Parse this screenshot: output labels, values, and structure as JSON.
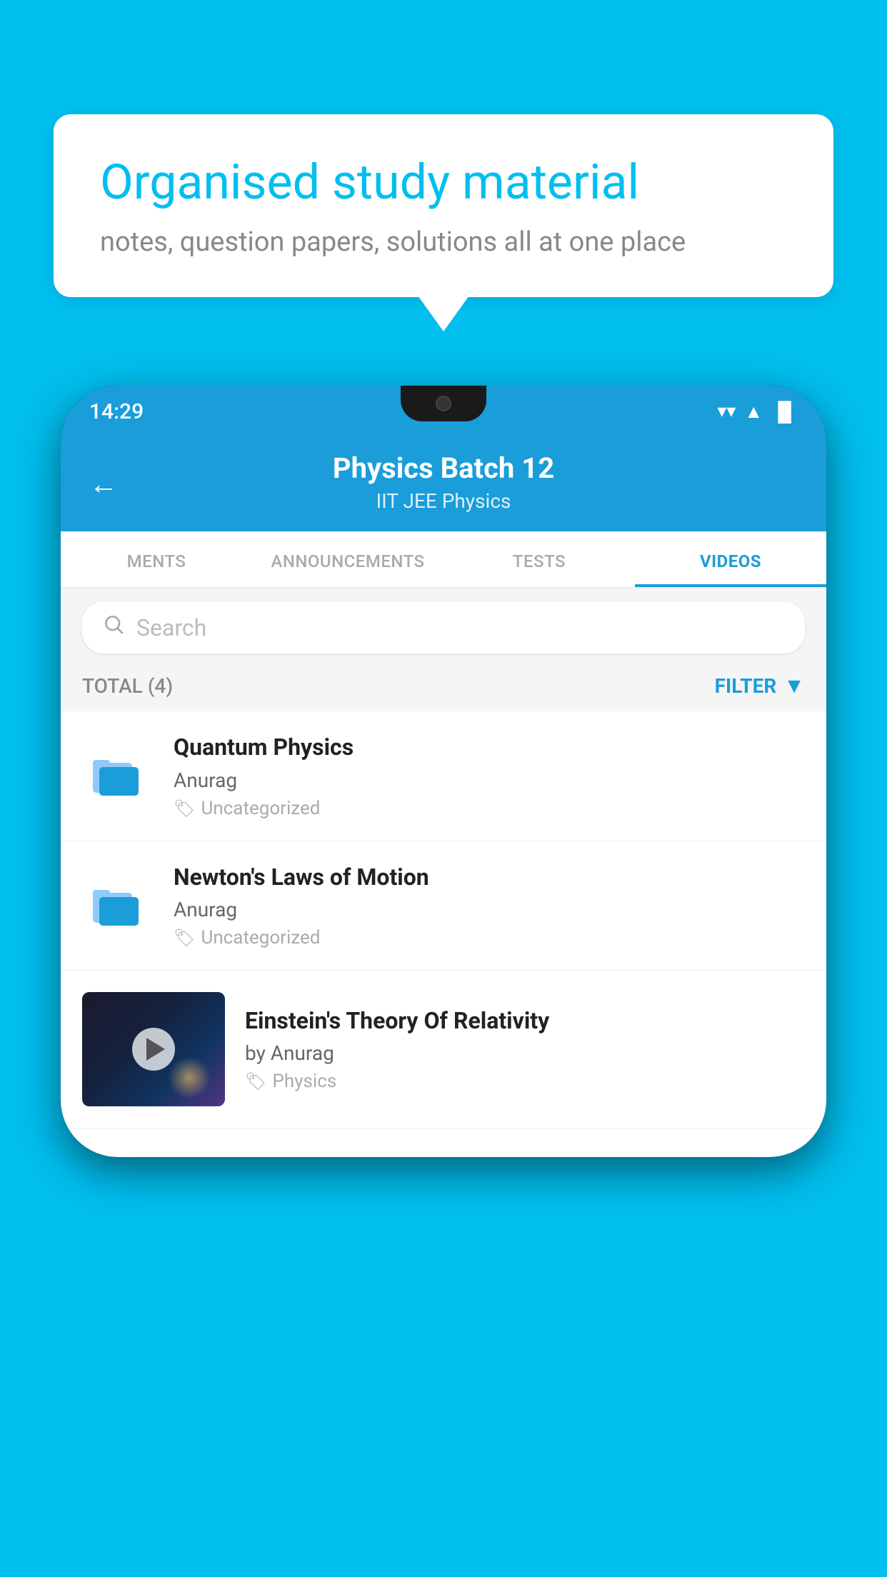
{
  "background": {
    "color": "#00BFEF"
  },
  "speech_bubble": {
    "title": "Organised study material",
    "subtitle": "notes, question papers, solutions all at one place"
  },
  "phone": {
    "status_bar": {
      "time": "14:29",
      "wifi": "▼",
      "signal": "◀",
      "battery": "▐"
    },
    "header": {
      "back_label": "←",
      "title": "Physics Batch 12",
      "subtitle": "IIT JEE   Physics"
    },
    "tabs": [
      {
        "label": "MENTS",
        "active": false
      },
      {
        "label": "ANNOUNCEMENTS",
        "active": false
      },
      {
        "label": "TESTS",
        "active": false
      },
      {
        "label": "VIDEOS",
        "active": true
      }
    ],
    "search": {
      "placeholder": "Search"
    },
    "filter_bar": {
      "total_label": "TOTAL (4)",
      "filter_label": "FILTER"
    },
    "videos": [
      {
        "id": 1,
        "title": "Quantum Physics",
        "author": "Anurag",
        "tag": "Uncategorized",
        "type": "folder"
      },
      {
        "id": 2,
        "title": "Newton's Laws of Motion",
        "author": "Anurag",
        "tag": "Uncategorized",
        "type": "folder"
      },
      {
        "id": 3,
        "title": "Einstein's Theory Of Relativity",
        "author": "by Anurag",
        "tag": "Physics",
        "type": "video"
      }
    ]
  }
}
